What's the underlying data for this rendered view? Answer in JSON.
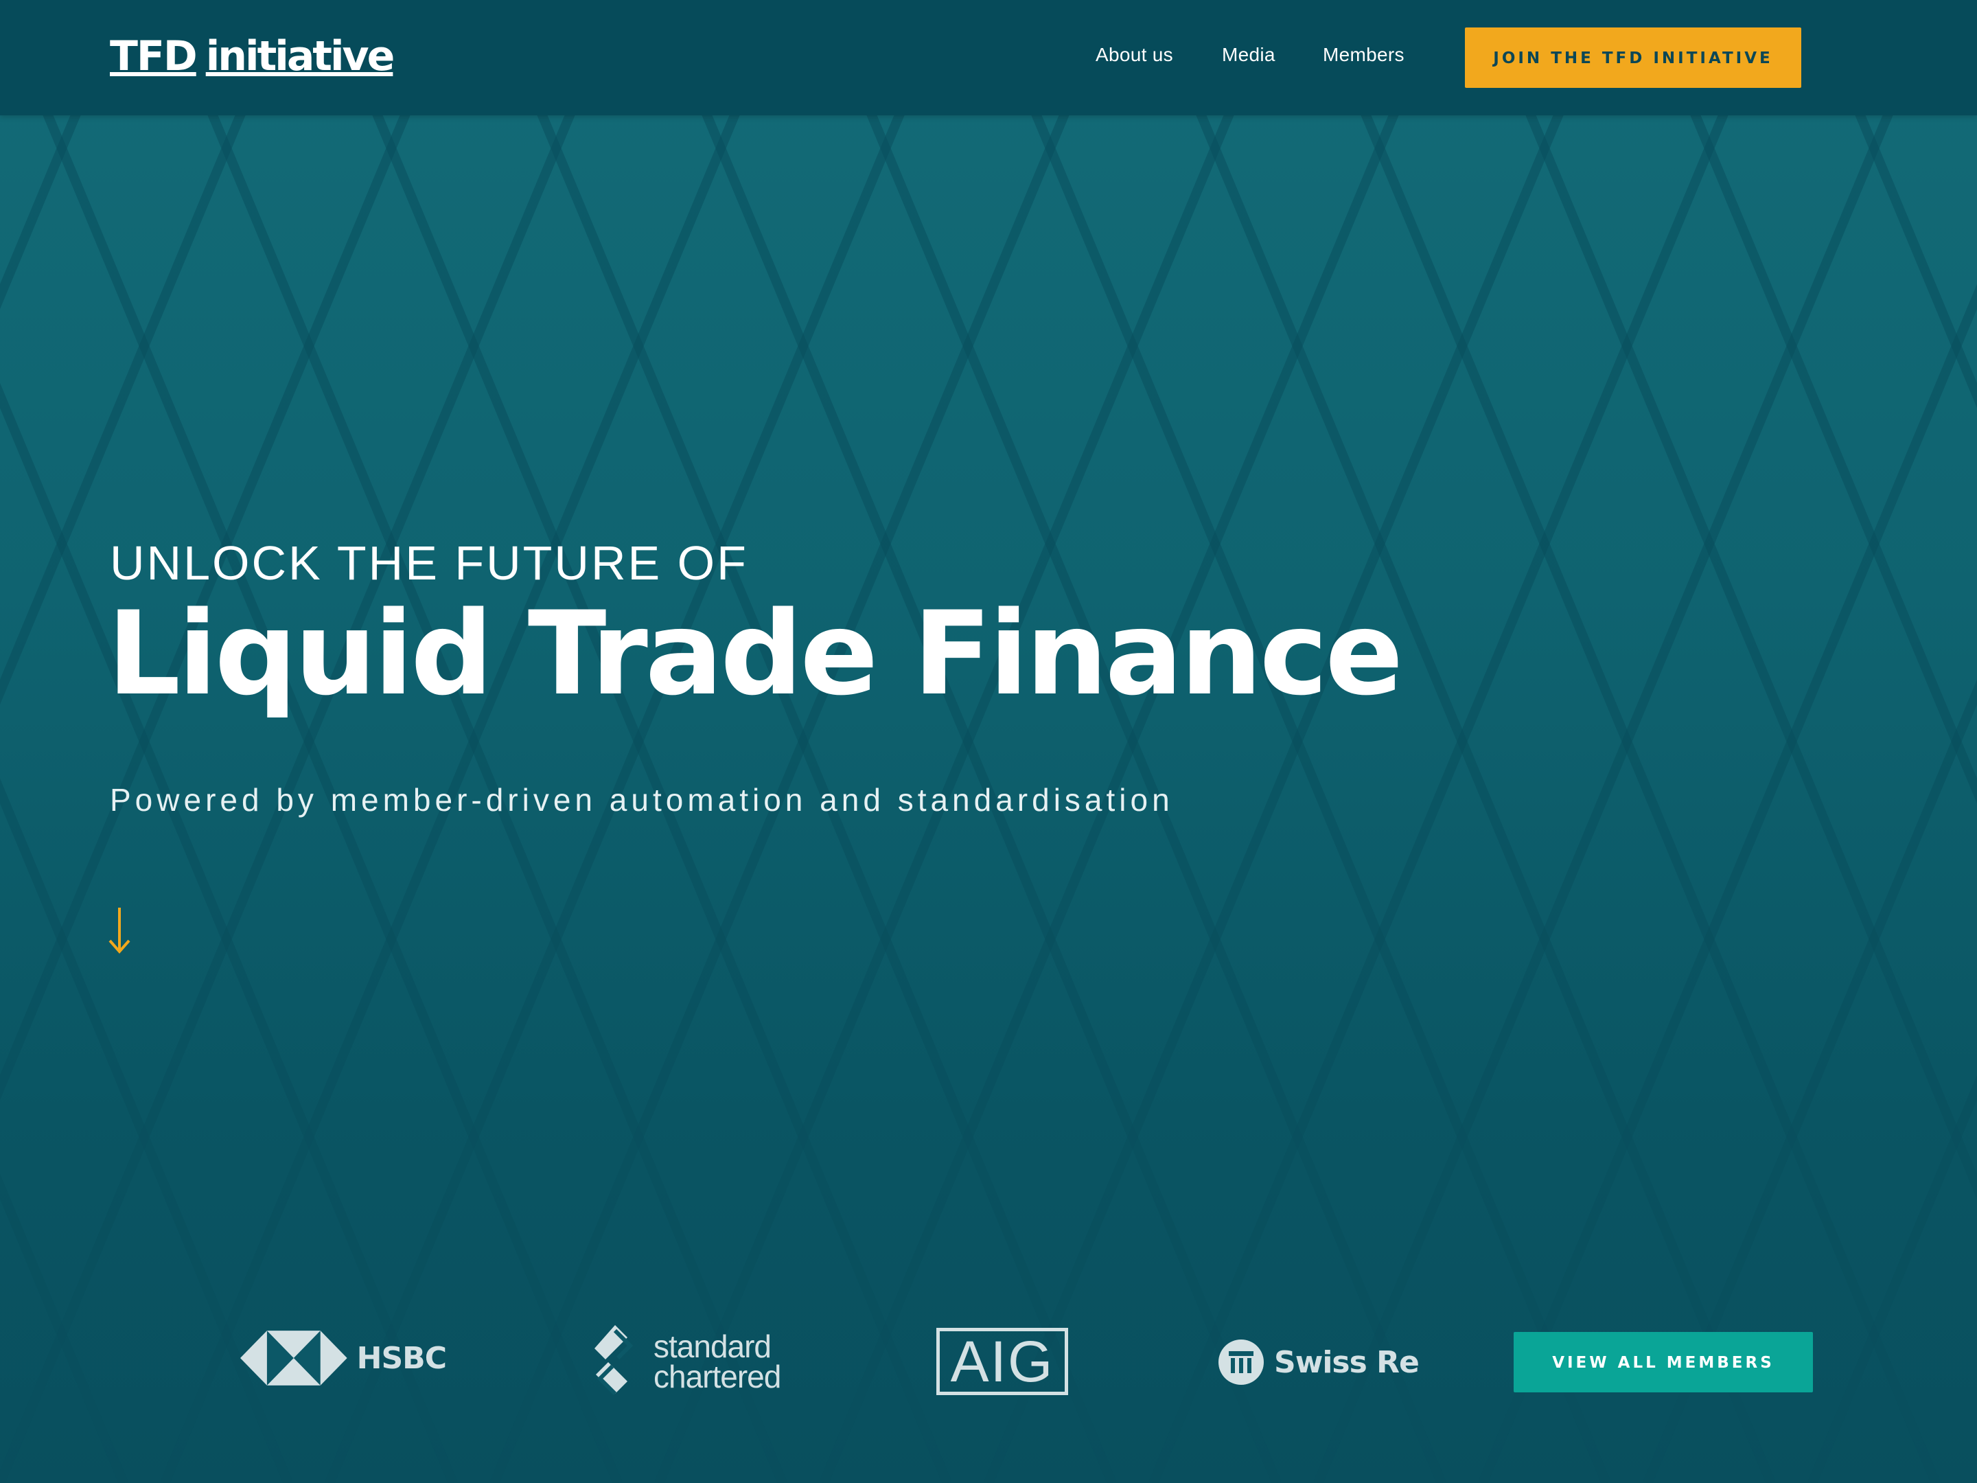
{
  "header": {
    "logo_mark": "TFD",
    "logo_word": "initiative",
    "nav": [
      {
        "label": "About us"
      },
      {
        "label": "Media"
      },
      {
        "label": "Members"
      }
    ],
    "cta_label": "JOIN THE TFD INITIATIVE"
  },
  "hero": {
    "kicker": "UNLOCK THE FUTURE OF",
    "title": "Liquid Trade Finance",
    "subtitle": "Powered by member-driven automation and standardisation",
    "scroll_icon": "arrow-down-icon"
  },
  "members": {
    "logos": [
      {
        "name": "HSBC",
        "icon": "hsbc-hexagon-icon"
      },
      {
        "name_line1": "standard",
        "name_line2": "chartered",
        "icon": "standard-chartered-icon"
      },
      {
        "name": "AIG"
      },
      {
        "name": "Swiss Re",
        "icon": "swiss-re-emblem-icon"
      }
    ],
    "cta_label": "VIEW ALL MEMBERS"
  },
  "colors": {
    "header_bg": "#064b5a",
    "hero_bg": "#0f6370",
    "accent_yellow": "#f2a81d",
    "accent_teal": "#0aa597",
    "logo_grey": "#d4e1e4",
    "text_white": "#ffffff"
  }
}
